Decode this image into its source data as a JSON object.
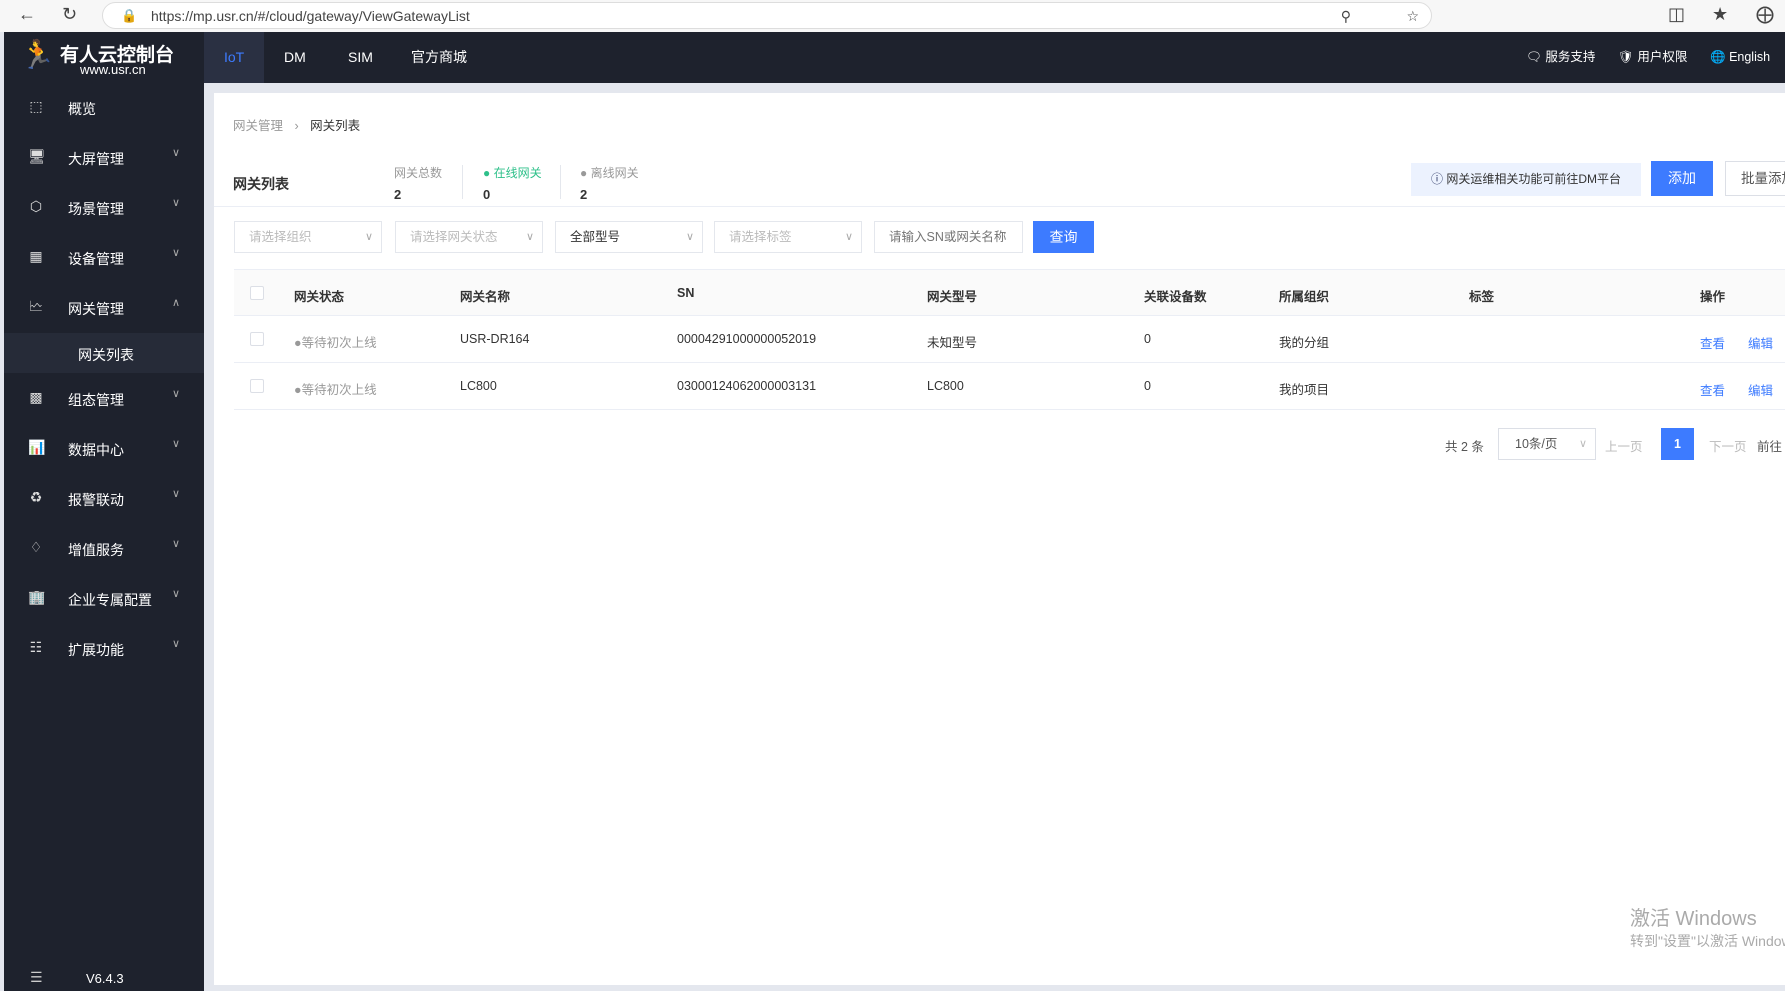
{
  "browser": {
    "url": "https://mp.usr.cn/#/cloud/gateway/ViewGatewayList"
  },
  "header": {
    "logo_title": "有人云控制台",
    "logo_sub": "www.usr.cn",
    "tabs": [
      {
        "label": "IoT",
        "active": true
      },
      {
        "label": "DM"
      },
      {
        "label": "SIM"
      },
      {
        "label": "官方商城"
      }
    ],
    "links": {
      "support": "服务支持",
      "permission": "用户权限",
      "language": "English"
    }
  },
  "sidebar": {
    "items": [
      {
        "label": "概览",
        "icon": "overview-icon"
      },
      {
        "label": "大屏管理",
        "icon": "screen-icon"
      },
      {
        "label": "场景管理",
        "icon": "scene-icon"
      },
      {
        "label": "设备管理",
        "icon": "device-icon"
      },
      {
        "label": "网关管理",
        "icon": "gateway-icon",
        "expanded": true
      },
      {
        "label": "网关列表",
        "sub": true,
        "active": true
      },
      {
        "label": "组态管理",
        "icon": "topology-icon"
      },
      {
        "label": "数据中心",
        "icon": "chart-icon"
      },
      {
        "label": "报警联动",
        "icon": "alarm-icon"
      },
      {
        "label": "增值服务",
        "icon": "diamond-icon"
      },
      {
        "label": "企业专属配置",
        "icon": "enterprise-icon"
      },
      {
        "label": "扩展功能",
        "icon": "grid-icon"
      }
    ],
    "version": "V6.4.3"
  },
  "breadcrumb": [
    "网关管理",
    "网关列表"
  ],
  "page": {
    "title": "网关列表",
    "stats": [
      {
        "label": "网关总数",
        "value": "2"
      },
      {
        "label": "在线网关",
        "value": "0"
      },
      {
        "label": "离线网关",
        "value": "2"
      }
    ],
    "notice": "网关运维相关功能可前往DM平台",
    "add": "添加",
    "batch_add": "批量添加"
  },
  "filters": {
    "org": "请选择组织",
    "status": "请选择网关状态",
    "model": "全部型号",
    "tag": "请选择标签",
    "search_placeholder": "请输入SN或网关名称",
    "query": "查询"
  },
  "table": {
    "columns": [
      "网关状态",
      "网关名称",
      "SN",
      "网关型号",
      "关联设备数",
      "所属组织",
      "标签",
      "操作"
    ],
    "rows": [
      {
        "status": "等待初次上线",
        "name": "USR-DR164",
        "sn": "00004291000000052019",
        "model": "未知型号",
        "devices": "0",
        "org": "我的分组",
        "tag": ""
      },
      {
        "status": "等待初次上线",
        "name": "LC800",
        "sn": "03000124062000003131",
        "model": "LC800",
        "devices": "0",
        "org": "我的项目",
        "tag": ""
      }
    ],
    "actions": {
      "view": "查看",
      "edit": "编辑"
    }
  },
  "pagination": {
    "total": "共 2 条",
    "page_size": "10条/页",
    "prev": "上一页",
    "current": "1",
    "next": "下一页",
    "goto": "前往"
  },
  "watermark": {
    "line1": "激活 Windows",
    "line2": "转到\"设置\"以激活 Windows。"
  },
  "colors": {
    "primary": "#3d7bff",
    "online": "#2ec08a",
    "header_bg": "#1e222d"
  }
}
